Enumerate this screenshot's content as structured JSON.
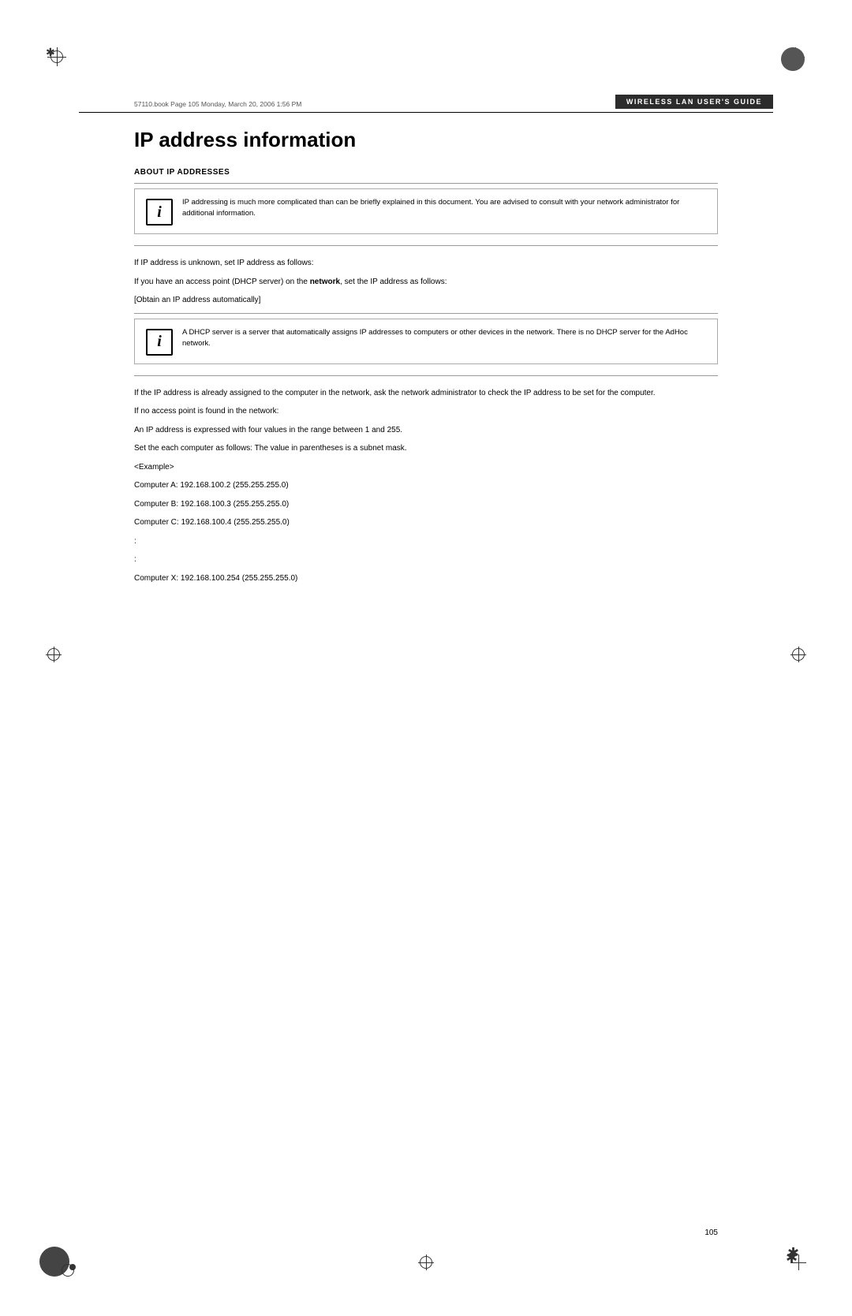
{
  "page": {
    "number": "105",
    "header_bar_label": "Wireless LAN User's Guide",
    "file_info": "57110.book  Page 105  Monday, March 20, 2006  1:56 PM"
  },
  "title": "IP address information",
  "sections": {
    "about_ip": {
      "heading": "ABOUT IP ADDRESSES",
      "info_box_1": {
        "icon": "i",
        "text": "IP addressing is much more complicated than can be briefly explained in this document. You are advised to consult with your network administrator for additional information."
      },
      "para1": "If IP address is unknown, set IP address as follows:",
      "para2": "If you have an access point (DHCP server) on the network, set the IP address as follows:",
      "para3": "[Obtain an IP address automatically]",
      "info_box_2": {
        "icon": "i",
        "text": "A DHCP server is a server that automatically assigns IP addresses to computers or other devices in the network. There is no DHCP server for the AdHoc network."
      },
      "para4": "If the IP address is already assigned to the computer in the network, ask the network administrator to check the IP address to be set for the computer.",
      "para5": "If no access point is found in the network:",
      "para6": "An IP address is expressed with four values in the range between 1 and 255.",
      "para7": "Set the each computer as follows: The value in parentheses is a subnet mask.",
      "example_label": "<Example>",
      "computer_a": "Computer A: 192.168.100.2 (255.255.255.0)",
      "computer_b": "Computer B: 192.168.100.3 (255.255.255.0)",
      "computer_c": "Computer C: 192.168.100.4 (255.255.255.0)",
      "dots1": ":",
      "dots2": ":",
      "computer_x": "Computer X: 192.168.100.254 (255.255.255.0)"
    }
  }
}
